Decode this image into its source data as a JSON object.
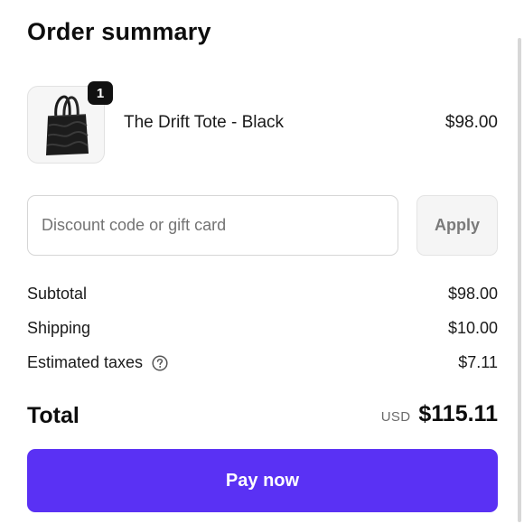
{
  "header": {
    "title": "Order summary"
  },
  "line_items": [
    {
      "name": "The Drift Tote - Black",
      "quantity": "1",
      "price": "$98.00",
      "image_icon": "tote-bag-image"
    }
  ],
  "discount": {
    "value": "",
    "placeholder": "Discount code or gift card",
    "apply_label": "Apply"
  },
  "summary": {
    "subtotal_label": "Subtotal",
    "subtotal_value": "$98.00",
    "shipping_label": "Shipping",
    "shipping_value": "$10.00",
    "taxes_label": "Estimated taxes",
    "taxes_value": "$7.11",
    "taxes_icon": "question-circle-icon"
  },
  "total": {
    "label": "Total",
    "currency": "USD",
    "amount": "$115.11"
  },
  "pay": {
    "label": "Pay now"
  },
  "colors": {
    "primary_button": "#5a31f4",
    "badge": "#111111",
    "apply_button_bg": "#f5f5f5"
  }
}
